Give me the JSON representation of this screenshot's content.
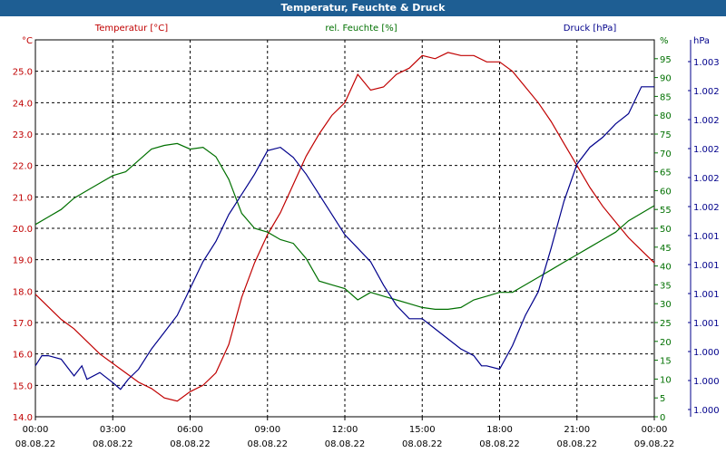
{
  "title": "Temperatur, Feuchte & Druck",
  "colors": {
    "title_bg": "#1e5e93",
    "temperature": "#c00000",
    "humidity": "#007000",
    "pressure": "#00008b",
    "grid": "#000000"
  },
  "chart_data": {
    "type": "line",
    "title": "Temperatur, Feuchte & Druck",
    "grid": true,
    "x_axis": {
      "range_hours": [
        0,
        24
      ],
      "ticks": [
        {
          "h": 0,
          "time": "00:00",
          "date": "08.08.22"
        },
        {
          "h": 3,
          "time": "03:00",
          "date": "08.08.22"
        },
        {
          "h": 6,
          "time": "06:00",
          "date": "08.08.22"
        },
        {
          "h": 9,
          "time": "09:00",
          "date": "08.08.22"
        },
        {
          "h": 12,
          "time": "12:00",
          "date": "08.08.22"
        },
        {
          "h": 15,
          "time": "15:00",
          "date": "08.08.22"
        },
        {
          "h": 18,
          "time": "18:00",
          "date": "08.08.22"
        },
        {
          "h": 21,
          "time": "21:00",
          "date": "08.08.22"
        },
        {
          "h": 24,
          "time": "00:00",
          "date": "09.08.22"
        }
      ]
    },
    "axes": {
      "temperature": {
        "label": "Temperatur [°C]",
        "unit": "°C",
        "range": [
          14,
          26
        ],
        "ticks": [
          "14.0",
          "15.0",
          "16.0",
          "17.0",
          "18.0",
          "19.0",
          "20.0",
          "21.0",
          "22.0",
          "23.0",
          "24.0",
          "25.0"
        ]
      },
      "humidity": {
        "label": "rel. Feuchte [%]",
        "unit": "%",
        "range": [
          0,
          100
        ],
        "ticks": [
          "0",
          "5",
          "10",
          "15",
          "20",
          "25",
          "30",
          "35",
          "40",
          "45",
          "50",
          "55",
          "60",
          "65",
          "70",
          "75",
          "80",
          "85",
          "90",
          "95"
        ]
      },
      "pressure": {
        "label": "Druck [hPa]",
        "unit": "hPa",
        "ticks": [
          "1.000",
          "1.000",
          "1.000",
          "1.001",
          "1.001",
          "1.001",
          "1.001",
          "1.002",
          "1.002",
          "1.002",
          "1.002",
          "1.002",
          "1.003"
        ]
      }
    },
    "series": [
      {
        "name": "Temperatur [°C]",
        "axis": "temperature",
        "color": "#c00000",
        "points": [
          [
            0,
            17.9
          ],
          [
            0.5,
            17.5
          ],
          [
            1,
            17.1
          ],
          [
            1.5,
            16.8
          ],
          [
            2,
            16.4
          ],
          [
            2.5,
            16
          ],
          [
            3,
            15.7
          ],
          [
            3.5,
            15.4
          ],
          [
            4,
            15.1
          ],
          [
            4.5,
            14.9
          ],
          [
            5,
            14.6
          ],
          [
            5.5,
            14.5
          ],
          [
            6,
            14.8
          ],
          [
            6.5,
            15.0
          ],
          [
            7,
            15.4
          ],
          [
            7.5,
            16.3
          ],
          [
            8,
            17.8
          ],
          [
            8.5,
            18.9
          ],
          [
            9,
            19.8
          ],
          [
            9.5,
            20.5
          ],
          [
            10,
            21.4
          ],
          [
            10.5,
            22.3
          ],
          [
            11,
            23.0
          ],
          [
            11.5,
            23.6
          ],
          [
            12,
            24.0
          ],
          [
            12.5,
            24.9
          ],
          [
            13,
            24.4
          ],
          [
            13.5,
            24.5
          ],
          [
            14,
            24.9
          ],
          [
            14.5,
            25.1
          ],
          [
            15,
            25.5
          ],
          [
            15.5,
            25.4
          ],
          [
            16,
            25.6
          ],
          [
            16.5,
            25.5
          ],
          [
            17,
            25.5
          ],
          [
            17.5,
            25.3
          ],
          [
            18,
            25.3
          ],
          [
            18.5,
            25.0
          ],
          [
            19,
            24.5
          ],
          [
            19.5,
            24.0
          ],
          [
            20,
            23.4
          ],
          [
            20.5,
            22.7
          ],
          [
            21,
            22.0
          ],
          [
            21.5,
            21.3
          ],
          [
            22,
            20.7
          ],
          [
            22.5,
            20.2
          ],
          [
            23,
            19.7
          ],
          [
            23.5,
            19.3
          ],
          [
            24,
            18.9
          ]
        ]
      },
      {
        "name": "rel. Feuchte [%]",
        "axis": "humidity",
        "color": "#007000",
        "points": [
          [
            0,
            51
          ],
          [
            0.5,
            53
          ],
          [
            1,
            55
          ],
          [
            1.5,
            58
          ],
          [
            2,
            60
          ],
          [
            2.5,
            62
          ],
          [
            3,
            64
          ],
          [
            3.5,
            65
          ],
          [
            4,
            68
          ],
          [
            4.5,
            71
          ],
          [
            5,
            72
          ],
          [
            5.5,
            72.5
          ],
          [
            6,
            71
          ],
          [
            6.5,
            71.5
          ],
          [
            7,
            69
          ],
          [
            7.5,
            63
          ],
          [
            8,
            54
          ],
          [
            8.5,
            50
          ],
          [
            9,
            49
          ],
          [
            9.5,
            47
          ],
          [
            10,
            46
          ],
          [
            10.5,
            42
          ],
          [
            11,
            36
          ],
          [
            11.5,
            35
          ],
          [
            12,
            34
          ],
          [
            12.5,
            31
          ],
          [
            13,
            33
          ],
          [
            13.5,
            32
          ],
          [
            14,
            31
          ],
          [
            14.5,
            30
          ],
          [
            15,
            29
          ],
          [
            15.5,
            28.5
          ],
          [
            16,
            28.5
          ],
          [
            16.5,
            29
          ],
          [
            17,
            31
          ],
          [
            17.5,
            32
          ],
          [
            18,
            33
          ],
          [
            18.5,
            33
          ],
          [
            19,
            35
          ],
          [
            19.5,
            37
          ],
          [
            20,
            39
          ],
          [
            20.5,
            41
          ],
          [
            21,
            43
          ],
          [
            21.5,
            45
          ],
          [
            22,
            47
          ],
          [
            22.5,
            49
          ],
          [
            23,
            52
          ],
          [
            23.5,
            54
          ],
          [
            24,
            56
          ]
        ]
      },
      {
        "name": "Druck [hPa]",
        "axis": "pressure",
        "color": "#00008b",
        "points": [
          [
            0,
            0.13
          ],
          [
            0.25,
            0.16
          ],
          [
            0.5,
            0.16
          ],
          [
            1,
            0.15
          ],
          [
            1.3,
            0.12
          ],
          [
            1.5,
            0.1
          ],
          [
            1.8,
            0.13
          ],
          [
            2,
            0.09
          ],
          [
            2.5,
            0.11
          ],
          [
            3,
            0.08
          ],
          [
            3.3,
            0.06
          ],
          [
            3.6,
            0.09
          ],
          [
            4,
            0.12
          ],
          [
            4.5,
            0.18
          ],
          [
            5,
            0.23
          ],
          [
            5.5,
            0.28
          ],
          [
            6,
            0.36
          ],
          [
            6.5,
            0.44
          ],
          [
            7,
            0.5
          ],
          [
            7.5,
            0.58
          ],
          [
            8,
            0.64
          ],
          [
            8.5,
            0.7
          ],
          [
            9,
            0.77
          ],
          [
            9.5,
            0.78
          ],
          [
            10,
            0.75
          ],
          [
            10.5,
            0.7
          ],
          [
            11,
            0.64
          ],
          [
            11.5,
            0.58
          ],
          [
            12,
            0.52
          ],
          [
            12.5,
            0.48
          ],
          [
            13,
            0.44
          ],
          [
            13.5,
            0.37
          ],
          [
            14,
            0.31
          ],
          [
            14.5,
            0.27
          ],
          [
            15,
            0.27
          ],
          [
            15.5,
            0.24
          ],
          [
            16,
            0.21
          ],
          [
            16.5,
            0.18
          ],
          [
            17,
            0.16
          ],
          [
            17.3,
            0.13
          ],
          [
            17.5,
            0.13
          ],
          [
            18,
            0.12
          ],
          [
            18.5,
            0.19
          ],
          [
            19,
            0.28
          ],
          [
            19.5,
            0.35
          ],
          [
            20,
            0.48
          ],
          [
            20.5,
            0.62
          ],
          [
            21,
            0.73
          ],
          [
            21.5,
            0.78
          ],
          [
            22,
            0.81
          ],
          [
            22.5,
            0.85
          ],
          [
            23,
            0.88
          ],
          [
            23.5,
            0.96
          ],
          [
            24,
            0.96
          ]
        ]
      }
    ]
  }
}
